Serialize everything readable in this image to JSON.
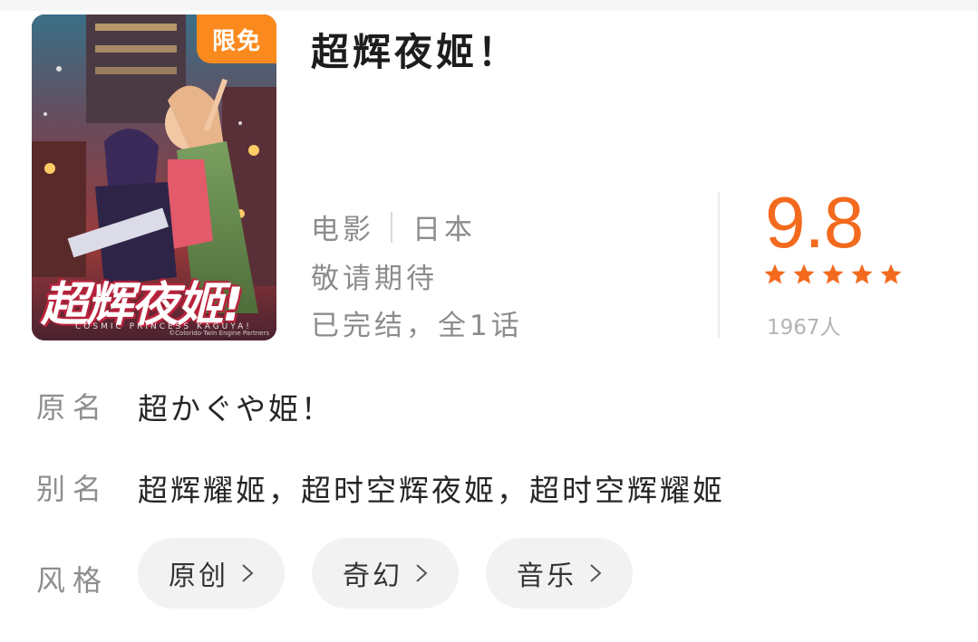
{
  "badge": "限免",
  "title": "超辉夜姬！",
  "poster": {
    "logo_text": "超辉夜姬!",
    "subtitle_text": "COSMIC PRINCESS KAGUYA!",
    "copyright_text": "©Colorido·Twin Engine Partners"
  },
  "meta": {
    "type": "电影",
    "region": "日本",
    "status": "敬请期待",
    "episodes": "已完结，全1话"
  },
  "rating": {
    "score": "9.8",
    "stars": 5,
    "count": "1967人"
  },
  "info": {
    "original_label": "原名",
    "original_value": "超かぐや姫！",
    "alias_label": "别名",
    "alias_value": "超辉耀姬，超时空辉夜姬，超时空辉耀姬",
    "style_label": "风格",
    "tags": [
      "原创",
      "奇幻",
      "音乐"
    ]
  },
  "colors": {
    "accent": "#f36a1e",
    "badge": "#fb8a1e"
  }
}
